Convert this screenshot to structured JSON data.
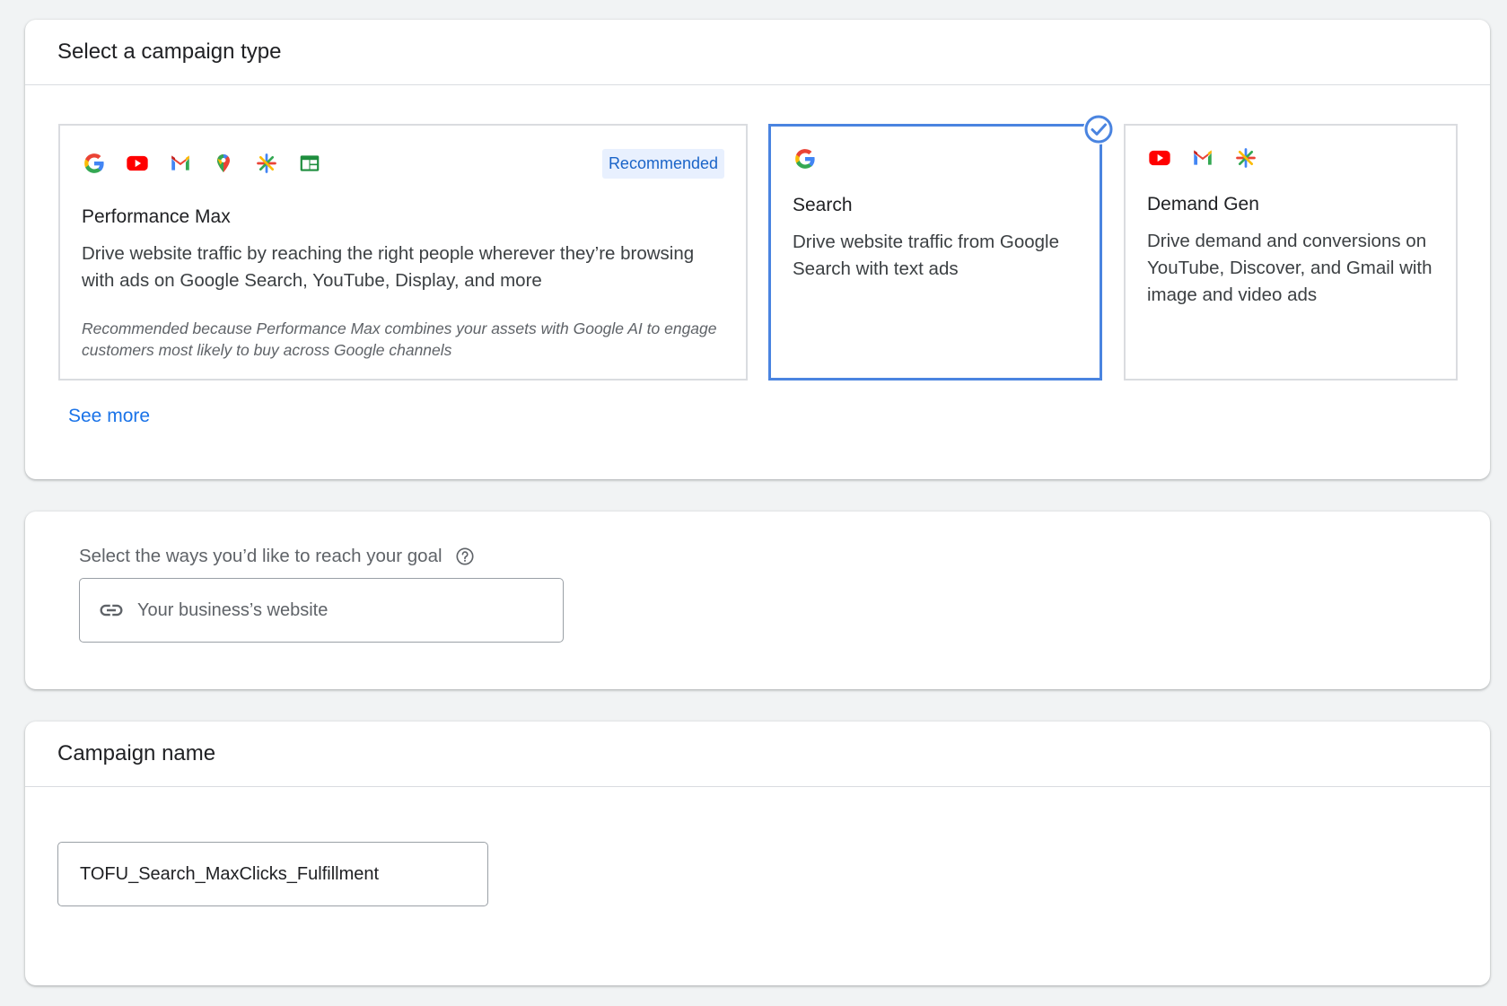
{
  "campaign_type": {
    "title": "Select a campaign type",
    "options": [
      {
        "name": "Performance Max",
        "badge": "Recommended",
        "description": "Drive website traffic by reaching the right people wherever they’re browsing with ads on Google Search, YouTube, Display, and more",
        "note": "Recommended because Performance Max combines your assets with Google AI to engage customers most likely to buy across Google channels",
        "icons": [
          "google-icon",
          "youtube-icon",
          "gmail-icon",
          "maps-icon",
          "discover-icon",
          "display-icon"
        ],
        "selected": false
      },
      {
        "name": "Search",
        "description": "Drive website traffic from Google Search with text ads",
        "icons": [
          "google-icon"
        ],
        "selected": true
      },
      {
        "name": "Demand Gen",
        "description": "Drive demand and conversions on YouTube, Discover, and Gmail with image and video ads",
        "icons": [
          "youtube-icon",
          "gmail-icon",
          "discover-icon"
        ],
        "selected": false
      }
    ],
    "see_more": "See more"
  },
  "goal": {
    "label": "Select the ways you’d like to reach your goal",
    "help_icon": "help-circle-icon",
    "website_placeholder": "Your business’s website",
    "website_icon": "link-icon"
  },
  "campaign_name": {
    "title": "Campaign name",
    "value": "TOFU_Search_MaxClicks_Fulfillment"
  },
  "colors": {
    "accent": "#1a73e8",
    "selected_border": "#4a84e0",
    "badge_bg": "#e8f0fe"
  }
}
